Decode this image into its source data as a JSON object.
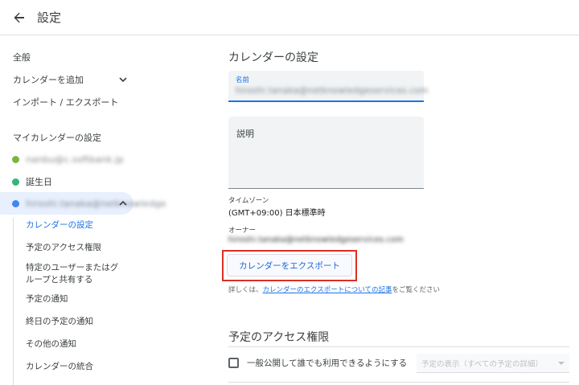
{
  "header": {
    "title": "設定",
    "back_icon": "arrow-back-icon"
  },
  "sidebar": {
    "general": "全般",
    "add_calendar": "カレンダーを追加",
    "import_export": "インポート / エクスポート",
    "my_calendars_heading": "マイカレンダーの設定",
    "calendars": [
      {
        "label": "nanbu@c.softbank.jp",
        "color": "#7cb342",
        "blurred": true
      },
      {
        "label": "誕生日",
        "color": "#33b679",
        "blurred": false
      },
      {
        "label": "hiroshi.tanaka@netknowledge",
        "color": "#4285f4",
        "blurred": true
      }
    ],
    "sub_items": [
      {
        "label": "カレンダーの設定",
        "active": true
      },
      {
        "label": "予定のアクセス権限",
        "active": false
      },
      {
        "label": "特定のユーザーまたはグループと共有する",
        "active": false
      },
      {
        "label": "予定の通知",
        "active": false
      },
      {
        "label": "終日の予定の通知",
        "active": false
      },
      {
        "label": "その他の通知",
        "active": false
      },
      {
        "label": "カレンダーの統合",
        "active": false
      }
    ]
  },
  "main": {
    "calendar_settings_title": "カレンダーの設定",
    "name_label": "名前",
    "name_value": "hiroshi.tanaka@netknowledgeservices.com",
    "description_label": "説明",
    "timezone_label": "タイムゾーン",
    "timezone_value": "(GMT+09:00) 日本標準時",
    "owner_label": "オーナー",
    "owner_value": "hiroshi.tanaka@netknowledgeservices.com",
    "export_button": "カレンダーをエクスポート",
    "help_prefix": "詳しくは、",
    "help_link": "カレンダーのエクスポートについての記事",
    "help_suffix": "をご覧ください",
    "access_title": "予定のアクセス権限",
    "public_checkbox_label": "一般公開して誰でも利用できるようにする",
    "visibility_select": "予定の表示（すべての予定の詳細）"
  },
  "colors": {
    "accent": "#1a73e8",
    "highlight": "#d93025"
  }
}
